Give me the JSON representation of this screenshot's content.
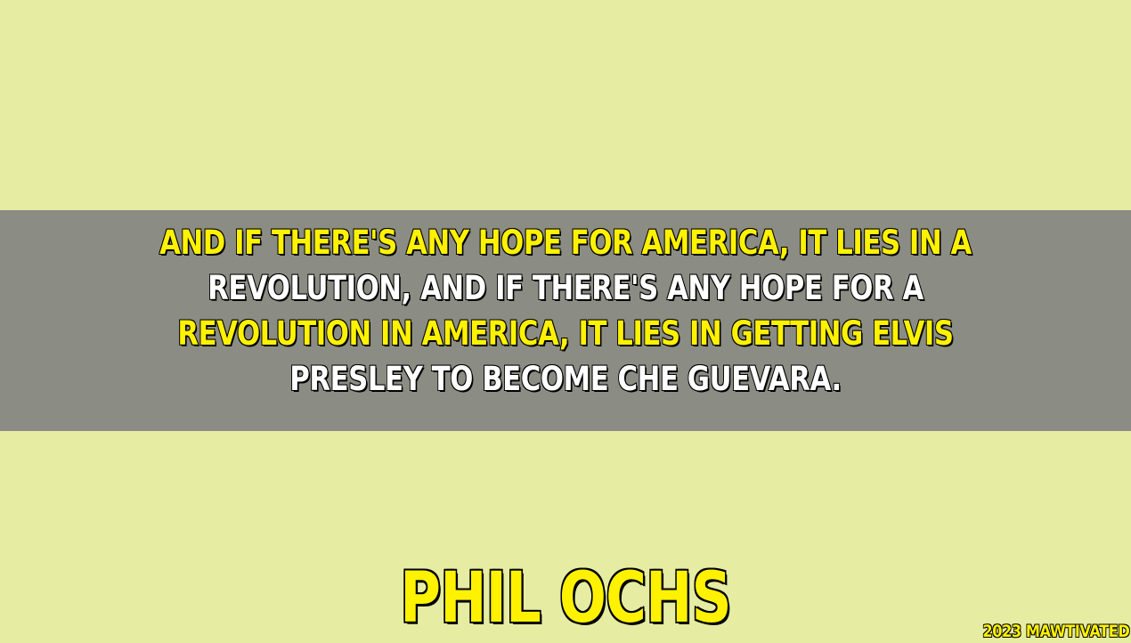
{
  "quote": {
    "lines": [
      {
        "text": "AND IF THERE'S ANY HOPE FOR AMERICA, IT LIES IN A",
        "color": "#fff200"
      },
      {
        "text": "REVOLUTION, AND IF THERE'S ANY HOPE FOR A",
        "color": "#ffffff"
      },
      {
        "text": "REVOLUTION IN AMERICA, IT LIES IN GETTING ELVIS",
        "color": "#fff200"
      },
      {
        "text": "PRESLEY TO BECOME CHE GUEVARA.",
        "color": "#ffffff"
      }
    ]
  },
  "author": "PHIL OCHS",
  "credit": "2023 MAWTIVATED",
  "colors": {
    "background": "#e6eca2",
    "band": "#8b8c84",
    "accent_yellow": "#fff200",
    "text_white": "#ffffff"
  }
}
